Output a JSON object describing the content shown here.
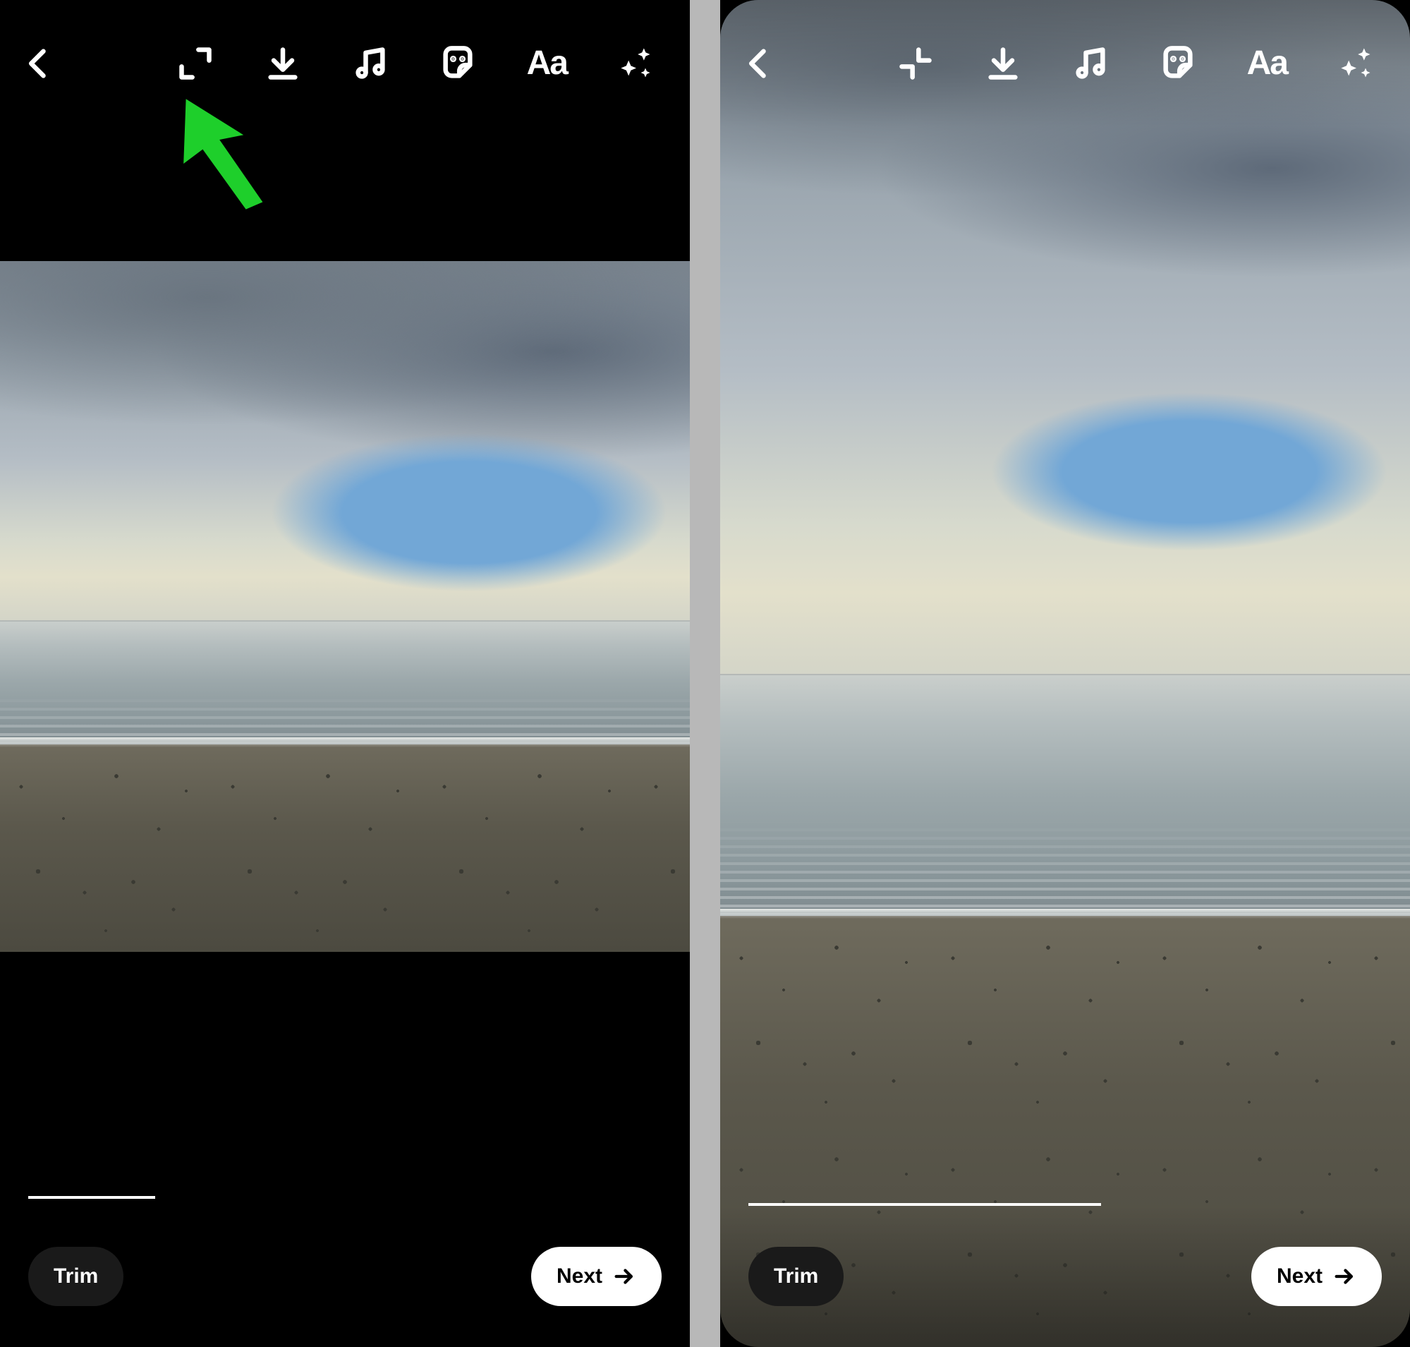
{
  "icons": {
    "back": "chevron-left-icon",
    "expand": "expand-icon",
    "collapse": "collapse-icon",
    "download": "download-icon",
    "music": "music-icon",
    "sticker": "sticker-icon",
    "text": "text-icon",
    "sparkle": "sparkle-icon",
    "next_arrow": "arrow-right-icon"
  },
  "toolbar": {
    "text_label": "Aa"
  },
  "bottom": {
    "trim_label": "Trim",
    "next_label": "Next"
  },
  "annotation": {
    "pointer_color": "#1ecf2b",
    "target_icon": "expand-icon"
  },
  "screens": {
    "left": {
      "top_crop_icon": "expand",
      "media_fullbleed": false
    },
    "right": {
      "top_crop_icon": "collapse",
      "media_fullbleed": true
    }
  }
}
